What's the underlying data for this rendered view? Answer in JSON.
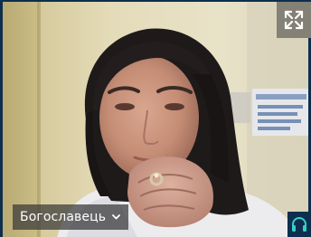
{
  "participant": {
    "name": "Богославець"
  },
  "icons": {
    "fullscreen": "fullscreen-expand-icon",
    "dropdown": "chevron-down-icon",
    "audio": "headphones-icon"
  },
  "colors": {
    "frame_border": "#0d2f4d",
    "audio_accent": "#35d0c8",
    "overlay_bg": "#373737",
    "wall": "#d9cfa9"
  }
}
